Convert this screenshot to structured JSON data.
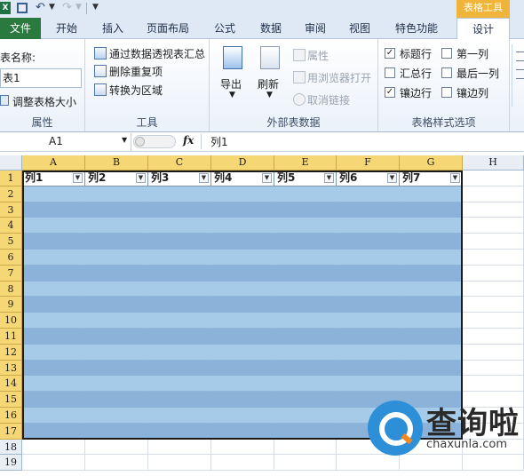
{
  "context_tab_title": "表格工具",
  "tabs": [
    {
      "label": "文件"
    },
    {
      "label": "开始"
    },
    {
      "label": "插入"
    },
    {
      "label": "页面布局"
    },
    {
      "label": "公式"
    },
    {
      "label": "数据"
    },
    {
      "label": "审阅"
    },
    {
      "label": "视图"
    },
    {
      "label": "特色功能"
    },
    {
      "label": "设计"
    }
  ],
  "ribbon": {
    "properties": {
      "name_label": "表名称:",
      "name_value": "表1",
      "resize_label": "调整表格大小",
      "group_label": "属性"
    },
    "tools": {
      "pivot_label": "通过数据透视表汇总",
      "remove_dup_label": "删除重复项",
      "convert_label": "转换为区域",
      "group_label": "工具"
    },
    "external": {
      "export_label": "导出",
      "refresh_label": "刷新",
      "properties_label": "属性",
      "browser_label": "用浏览器打开",
      "unlink_label": "取消链接",
      "group_label": "外部表数据"
    },
    "style_options": {
      "header_row": {
        "label": "标题行",
        "checked": true
      },
      "total_row": {
        "label": "汇总行",
        "checked": false
      },
      "banded_rows": {
        "label": "镶边行",
        "checked": true
      },
      "first_column": {
        "label": "第一列",
        "checked": false
      },
      "last_column": {
        "label": "最后一列",
        "checked": false
      },
      "banded_columns": {
        "label": "镶边列",
        "checked": false
      },
      "group_label": "表格样式选项"
    }
  },
  "formula_bar": {
    "name_box": "A1",
    "fx": "fx",
    "value": "列1"
  },
  "sheet": {
    "columns": [
      "A",
      "B",
      "C",
      "D",
      "E",
      "F",
      "G",
      "H"
    ],
    "rows": [
      "1",
      "2",
      "3",
      "4",
      "5",
      "6",
      "7",
      "8",
      "9",
      "10",
      "11",
      "12",
      "13",
      "14",
      "15",
      "16",
      "17",
      "18",
      "19"
    ],
    "table_headers": [
      "列1",
      "列2",
      "列3",
      "列4",
      "列5",
      "列6",
      "列7"
    ],
    "filter_glyph": "▼"
  },
  "watermark": {
    "title": "查询啦",
    "url": "chaxunla.com"
  },
  "colors": {
    "file_tab": "#2a7a3f",
    "context_tab": "#f0b43a",
    "band_light": "#a6cbe8",
    "band_dark": "#8bb3da",
    "header_highlight": "#f6d775"
  }
}
